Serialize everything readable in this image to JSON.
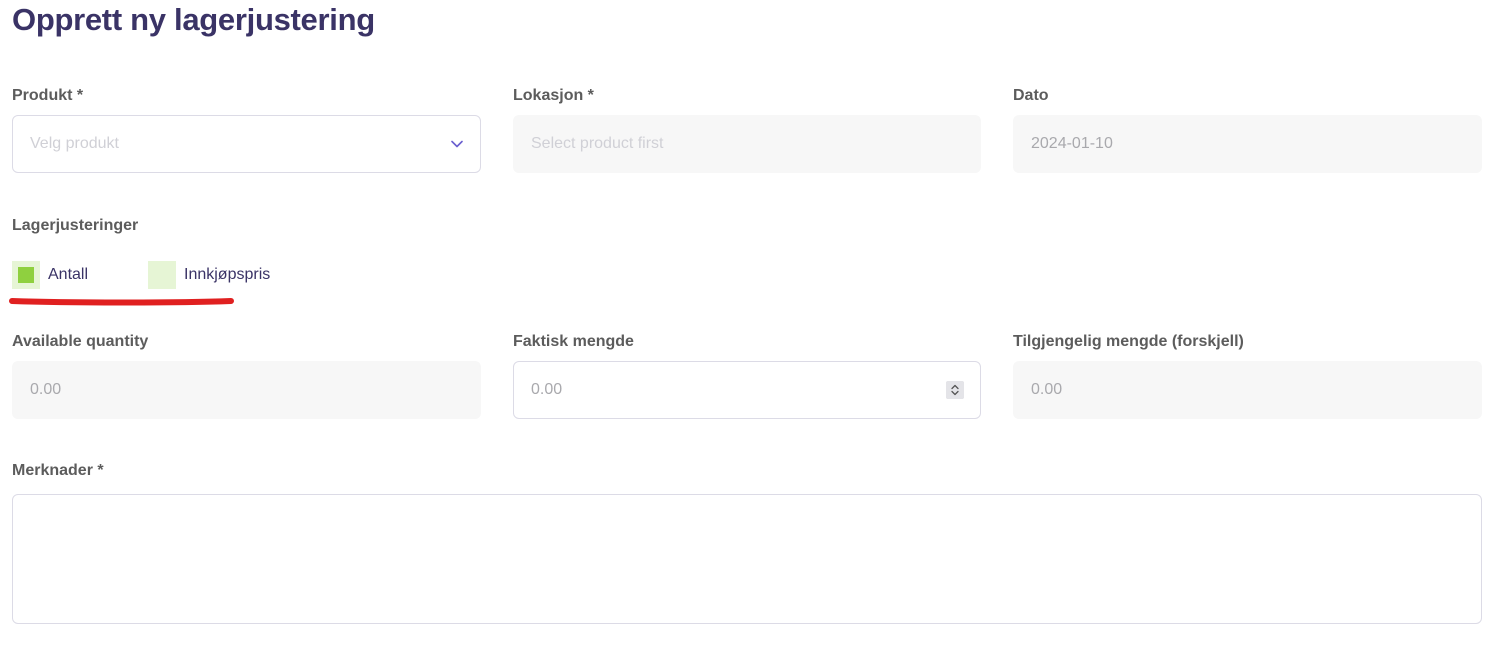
{
  "page": {
    "title": "Opprett ny lagerjustering"
  },
  "form": {
    "product": {
      "label": "Produkt *",
      "placeholder": "Velg produkt",
      "icon": "chevron-down-icon"
    },
    "location": {
      "label": "Lokasjon *",
      "placeholder": "Select product first"
    },
    "date": {
      "label": "Dato",
      "value": "2024-01-10"
    },
    "adjustments": {
      "label": "Lagerjusteringer",
      "options": [
        {
          "label": "Antall",
          "checked": true
        },
        {
          "label": "Innkjøpspris",
          "checked": false
        }
      ]
    },
    "available_quantity": {
      "label": "Available quantity",
      "value": "0.00"
    },
    "actual_quantity": {
      "label": "Faktisk mengde",
      "placeholder": "0.00"
    },
    "difference": {
      "label": "Tilgjengelig mengde (forskjell)",
      "value": "0.00"
    },
    "notes": {
      "label": "Merknader *",
      "value": ""
    }
  },
  "colors": {
    "title": "#3a3366",
    "checkbox_fill": "#8fd03f",
    "checkbox_bg": "#e6f5d5",
    "annotation": "#e02020"
  }
}
